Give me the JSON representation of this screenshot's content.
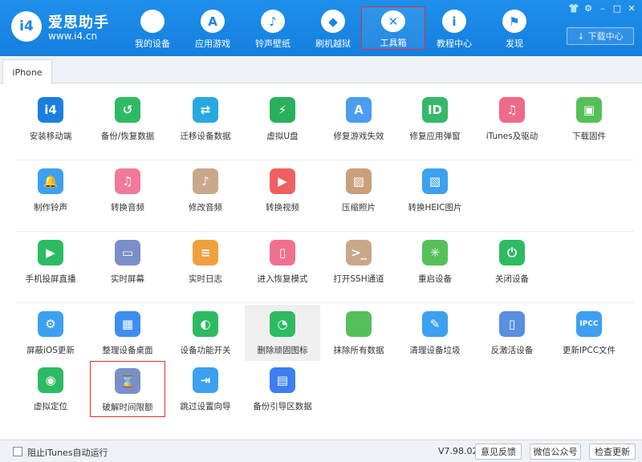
{
  "brand": {
    "name": "爱思助手",
    "url": "www.i4.cn",
    "logo_text": "i4"
  },
  "nav": [
    {
      "label": "我的设备",
      "icon": "",
      "active": false
    },
    {
      "label": "应用游戏",
      "icon": "A",
      "active": false
    },
    {
      "label": "铃声壁纸",
      "icon": "♪",
      "active": false
    },
    {
      "label": "刷机越狱",
      "icon": "◆",
      "active": false
    },
    {
      "label": "工具箱",
      "icon": "✕",
      "active": true
    },
    {
      "label": "教程中心",
      "icon": "i",
      "active": false
    },
    {
      "label": "发现",
      "icon": "⚑",
      "active": false
    }
  ],
  "window_controls": [
    "👕",
    "⚙",
    "–",
    "□",
    "✕"
  ],
  "download_center": "下载中心",
  "download_icon": "↓",
  "tab": "iPhone",
  "tools": [
    {
      "label": "安装移动端",
      "icon": "i4",
      "color": "#1a7fe0"
    },
    {
      "label": "备份/恢复数据",
      "icon": "↺",
      "color": "#2dbb62"
    },
    {
      "label": "迁移设备数据",
      "icon": "⇄",
      "color": "#27a9e0"
    },
    {
      "label": "虚拟U盘",
      "icon": "⚡",
      "color": "#2ab05c"
    },
    {
      "label": "修复游戏失效",
      "icon": "A",
      "color": "#4a9df0"
    },
    {
      "label": "修复应用弹窗",
      "icon": "ID",
      "color": "#35b86a"
    },
    {
      "label": "iTunes及驱动",
      "icon": "♫",
      "color": "#f06a8a"
    },
    {
      "label": "下载固件",
      "icon": "▣",
      "color": "#55c05a"
    },
    {
      "label": "制作铃声",
      "icon": "🔔",
      "color": "#3da0f0"
    },
    {
      "label": "转换音频",
      "icon": "♫",
      "color": "#f07a9a"
    },
    {
      "label": "修改音频",
      "icon": "♪",
      "color": "#c9a88a"
    },
    {
      "label": "转换视频",
      "icon": "▶",
      "color": "#f06060"
    },
    {
      "label": "压缩照片",
      "icon": "▨",
      "color": "#c9a07a"
    },
    {
      "label": "转换HEIC图片",
      "icon": "▧",
      "color": "#3da0f0"
    },
    {
      "label": "手机投屏直播",
      "icon": "▶",
      "color": "#2dbb62"
    },
    {
      "label": "实时屏幕",
      "icon": "▭",
      "color": "#7a8fc8"
    },
    {
      "label": "实时日志",
      "icon": "≡",
      "color": "#f0a040"
    },
    {
      "label": "进入恢复模式",
      "icon": "▯",
      "color": "#f07090"
    },
    {
      "label": "打开SSH通道",
      "icon": ">_",
      "color": "#c9a88a"
    },
    {
      "label": "重启设备",
      "icon": "✳",
      "color": "#55c05a"
    },
    {
      "label": "关闭设备",
      "icon": "⏻",
      "color": "#2dbb62"
    },
    {
      "label": "屏蔽iOS更新",
      "icon": "⚙",
      "color": "#3da0f0"
    },
    {
      "label": "整理设备桌面",
      "icon": "▦",
      "color": "#3d8ef0"
    },
    {
      "label": "设备功能开关",
      "icon": "◐",
      "color": "#2dbb62"
    },
    {
      "label": "删除顽固图标",
      "icon": "◔",
      "color": "#2dbb62"
    },
    {
      "label": "抹除所有数据",
      "icon": "",
      "color": "#55c05a"
    },
    {
      "label": "清理设备垃圾",
      "icon": "✎",
      "color": "#3da0f0"
    },
    {
      "label": "反激活设备",
      "icon": "▯",
      "color": "#5a8ee0"
    },
    {
      "label": "更新IPCC文件",
      "icon": "IPCC",
      "color": "#3da0f0"
    },
    {
      "label": "虚拟定位",
      "icon": "◉",
      "color": "#2dbb62"
    },
    {
      "label": "破解时间限额",
      "icon": "⌛",
      "color": "#7a8fc8"
    },
    {
      "label": "跳过设置向导",
      "icon": "⇥",
      "color": "#3da0f0"
    },
    {
      "label": "备份引导区数据",
      "icon": "▤",
      "color": "#3d7ef0"
    }
  ],
  "footer": {
    "checkbox_label": "阻止iTunes自动运行",
    "version": "V7.98.02",
    "feedback": "意见反馈",
    "wechat": "微信公众号",
    "check_update": "检查更新"
  }
}
